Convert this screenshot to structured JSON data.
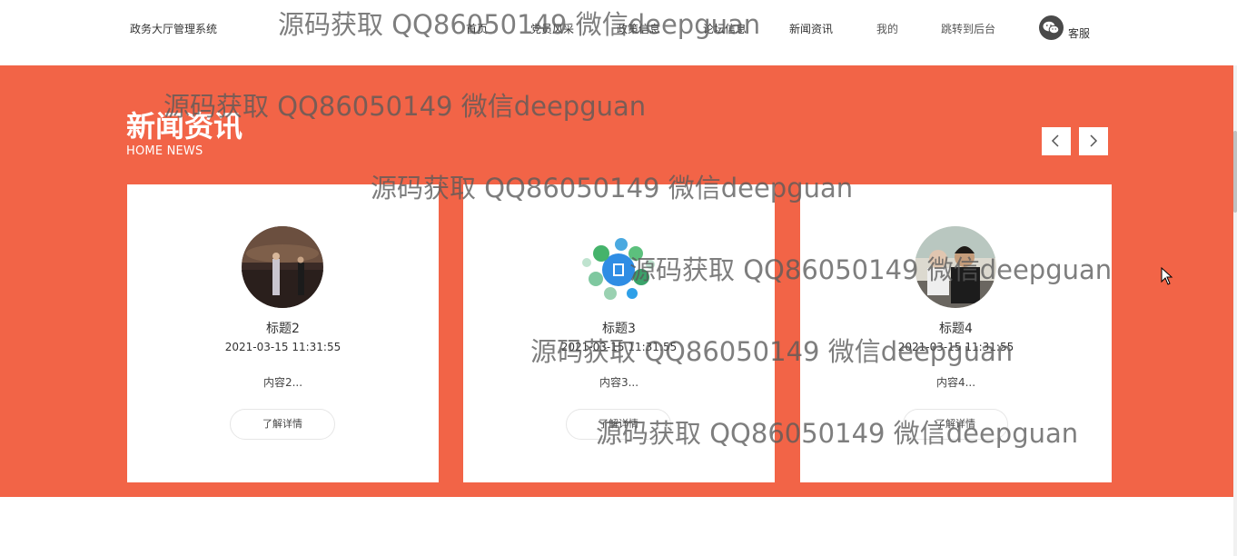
{
  "header": {
    "brand": "政务大厅管理系统",
    "nav": [
      "首页",
      "党员风采",
      "政策信息",
      "论坛信息",
      "新闻资讯",
      "我的",
      "跳转到后台"
    ],
    "service_label": "客服"
  },
  "news": {
    "title": "新闻资讯",
    "subtitle": "HOME NEWS",
    "cards": [
      {
        "title": "标题2",
        "date": "2021-03-15 11:31:55",
        "content": "内容2...",
        "button": "了解详情"
      },
      {
        "title": "标题3",
        "date": "2021-03-15 11:31:55",
        "content": "内容3...",
        "button": "了解详情"
      },
      {
        "title": "标题4",
        "date": "2021-03-15 11:31:55",
        "content": "内容4...",
        "button": "了解详情"
      }
    ]
  },
  "watermark": "源码获取 QQ86050149 微信deepguan",
  "colors": {
    "accent": "#f26447",
    "header_bg": "#ffffff",
    "card_bg": "#ffffff"
  },
  "icons": {
    "prev": "chevron-left-icon",
    "next": "chevron-right-icon",
    "service": "wechat-icon"
  }
}
